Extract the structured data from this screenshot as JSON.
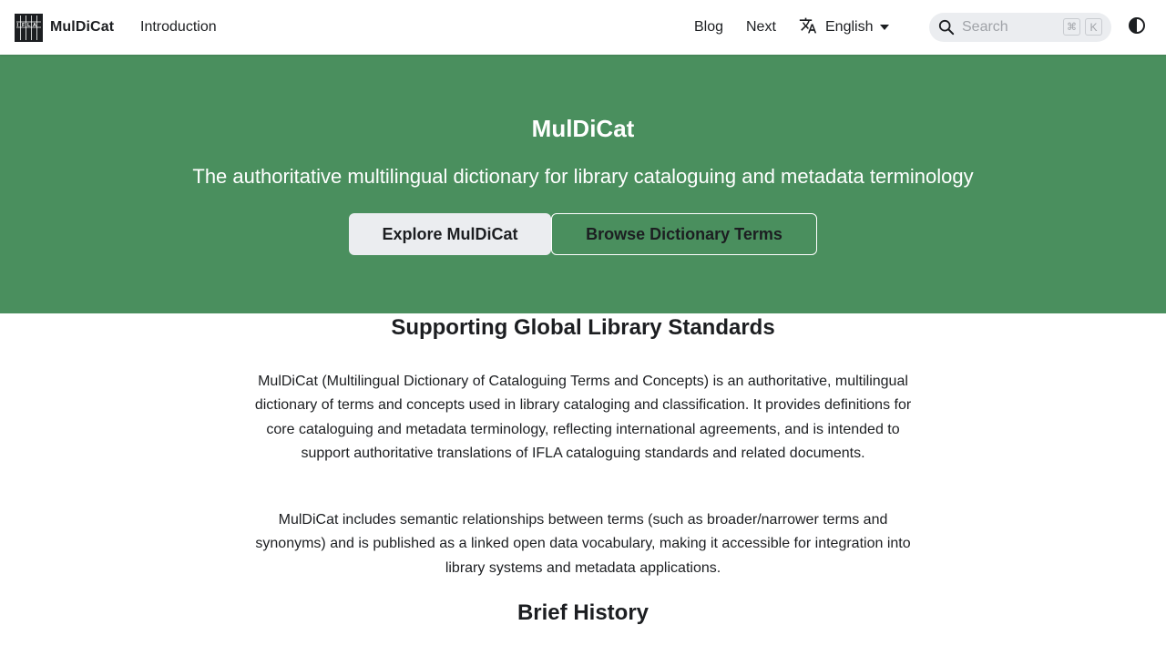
{
  "navbar": {
    "brand_title": "MulDiCat",
    "logo_icon": "ifla-logo-icon",
    "links": {
      "introduction": "Introduction",
      "blog": "Blog",
      "next": "Next"
    },
    "language": {
      "icon": "translate-icon",
      "selected": "English"
    },
    "search": {
      "placeholder": "Search",
      "shortcut_modifier": "⌘",
      "shortcut_key": "K"
    },
    "theme_toggle_icon": "contrast-icon"
  },
  "hero": {
    "background_color": "#4a8f5e",
    "title": "MulDiCat",
    "subtitle": "The authoritative multilingual dictionary for library cataloguing and metadata terminology",
    "buttons": {
      "explore": "Explore MulDiCat",
      "browse": "Browse Dictionary Terms"
    }
  },
  "main": {
    "section_standards": {
      "heading": "Supporting Global Library Standards",
      "paragraphs": [
        "MulDiCat (Multilingual Dictionary of Cataloguing Terms and Concepts) is an authoritative, multilingual dictionary of terms and concepts used in library cataloging and classification. It provides definitions for core cataloguing and metadata terminology, reflecting international agreements, and is intended to support authoritative translations of IFLA cataloguing standards and related documents.",
        "MulDiCat includes semantic relationships between terms (such as broader/narrower terms and synonyms) and is published as a linked open data vocabulary, making it accessible for integration into library systems and metadata applications."
      ]
    },
    "section_history": {
      "heading": "Brief History"
    }
  }
}
